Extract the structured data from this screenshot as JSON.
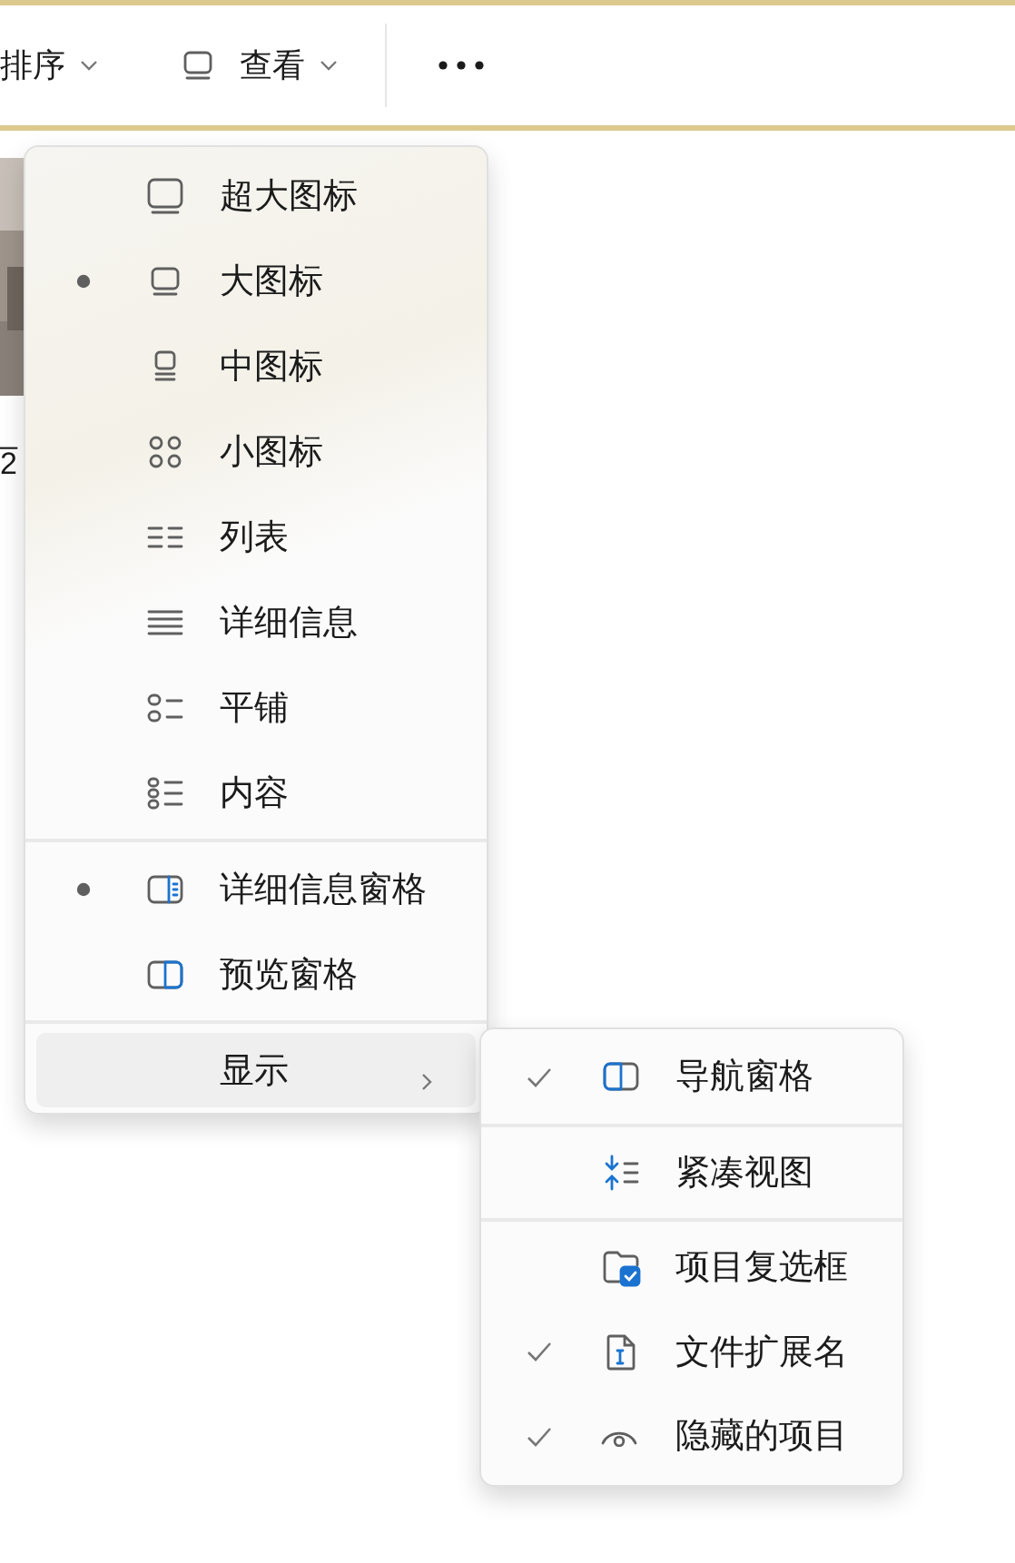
{
  "toolbar": {
    "sort_button": {
      "label": "排序"
    },
    "view_button": {
      "label": "查看"
    }
  },
  "background": {
    "thumbnail": {
      "kind": "picture"
    },
    "file_name_fragments": [
      "_",
      "2"
    ]
  },
  "view_menu": {
    "groups": [
      [
        {
          "label": "超大图标",
          "kind": "extra-large",
          "selected": false
        },
        {
          "label": "大图标",
          "kind": "large",
          "selected": true
        },
        {
          "label": "中图标",
          "kind": "medium",
          "selected": false
        },
        {
          "label": "小图标",
          "kind": "small",
          "selected": false
        },
        {
          "label": "列表",
          "kind": "list",
          "selected": false
        },
        {
          "label": "详细信息",
          "kind": "details",
          "selected": false
        },
        {
          "label": "平铺",
          "kind": "tiles",
          "selected": false
        },
        {
          "label": "内容",
          "kind": "content",
          "selected": false
        }
      ],
      [
        {
          "label": "详细信息窗格",
          "kind": "details-pane",
          "selected": true
        },
        {
          "label": "预览窗格",
          "kind": "preview-pane",
          "selected": false
        }
      ],
      [
        {
          "label": "显示",
          "submenu": true,
          "hovered": true
        }
      ]
    ]
  },
  "show_submenu": {
    "groups": [
      [
        {
          "label": "导航窗格",
          "kind": "navigation-pane",
          "checked": true
        }
      ],
      [
        {
          "label": "紧凑视图",
          "kind": "compact",
          "checked": false
        }
      ],
      [
        {
          "label": "项目复选框",
          "kind": "checkboxes",
          "checked": false
        },
        {
          "label": "文件扩展名",
          "kind": "extension",
          "checked": true
        },
        {
          "label": "隐藏的项目",
          "kind": "hidden",
          "checked": true
        }
      ]
    ]
  }
}
